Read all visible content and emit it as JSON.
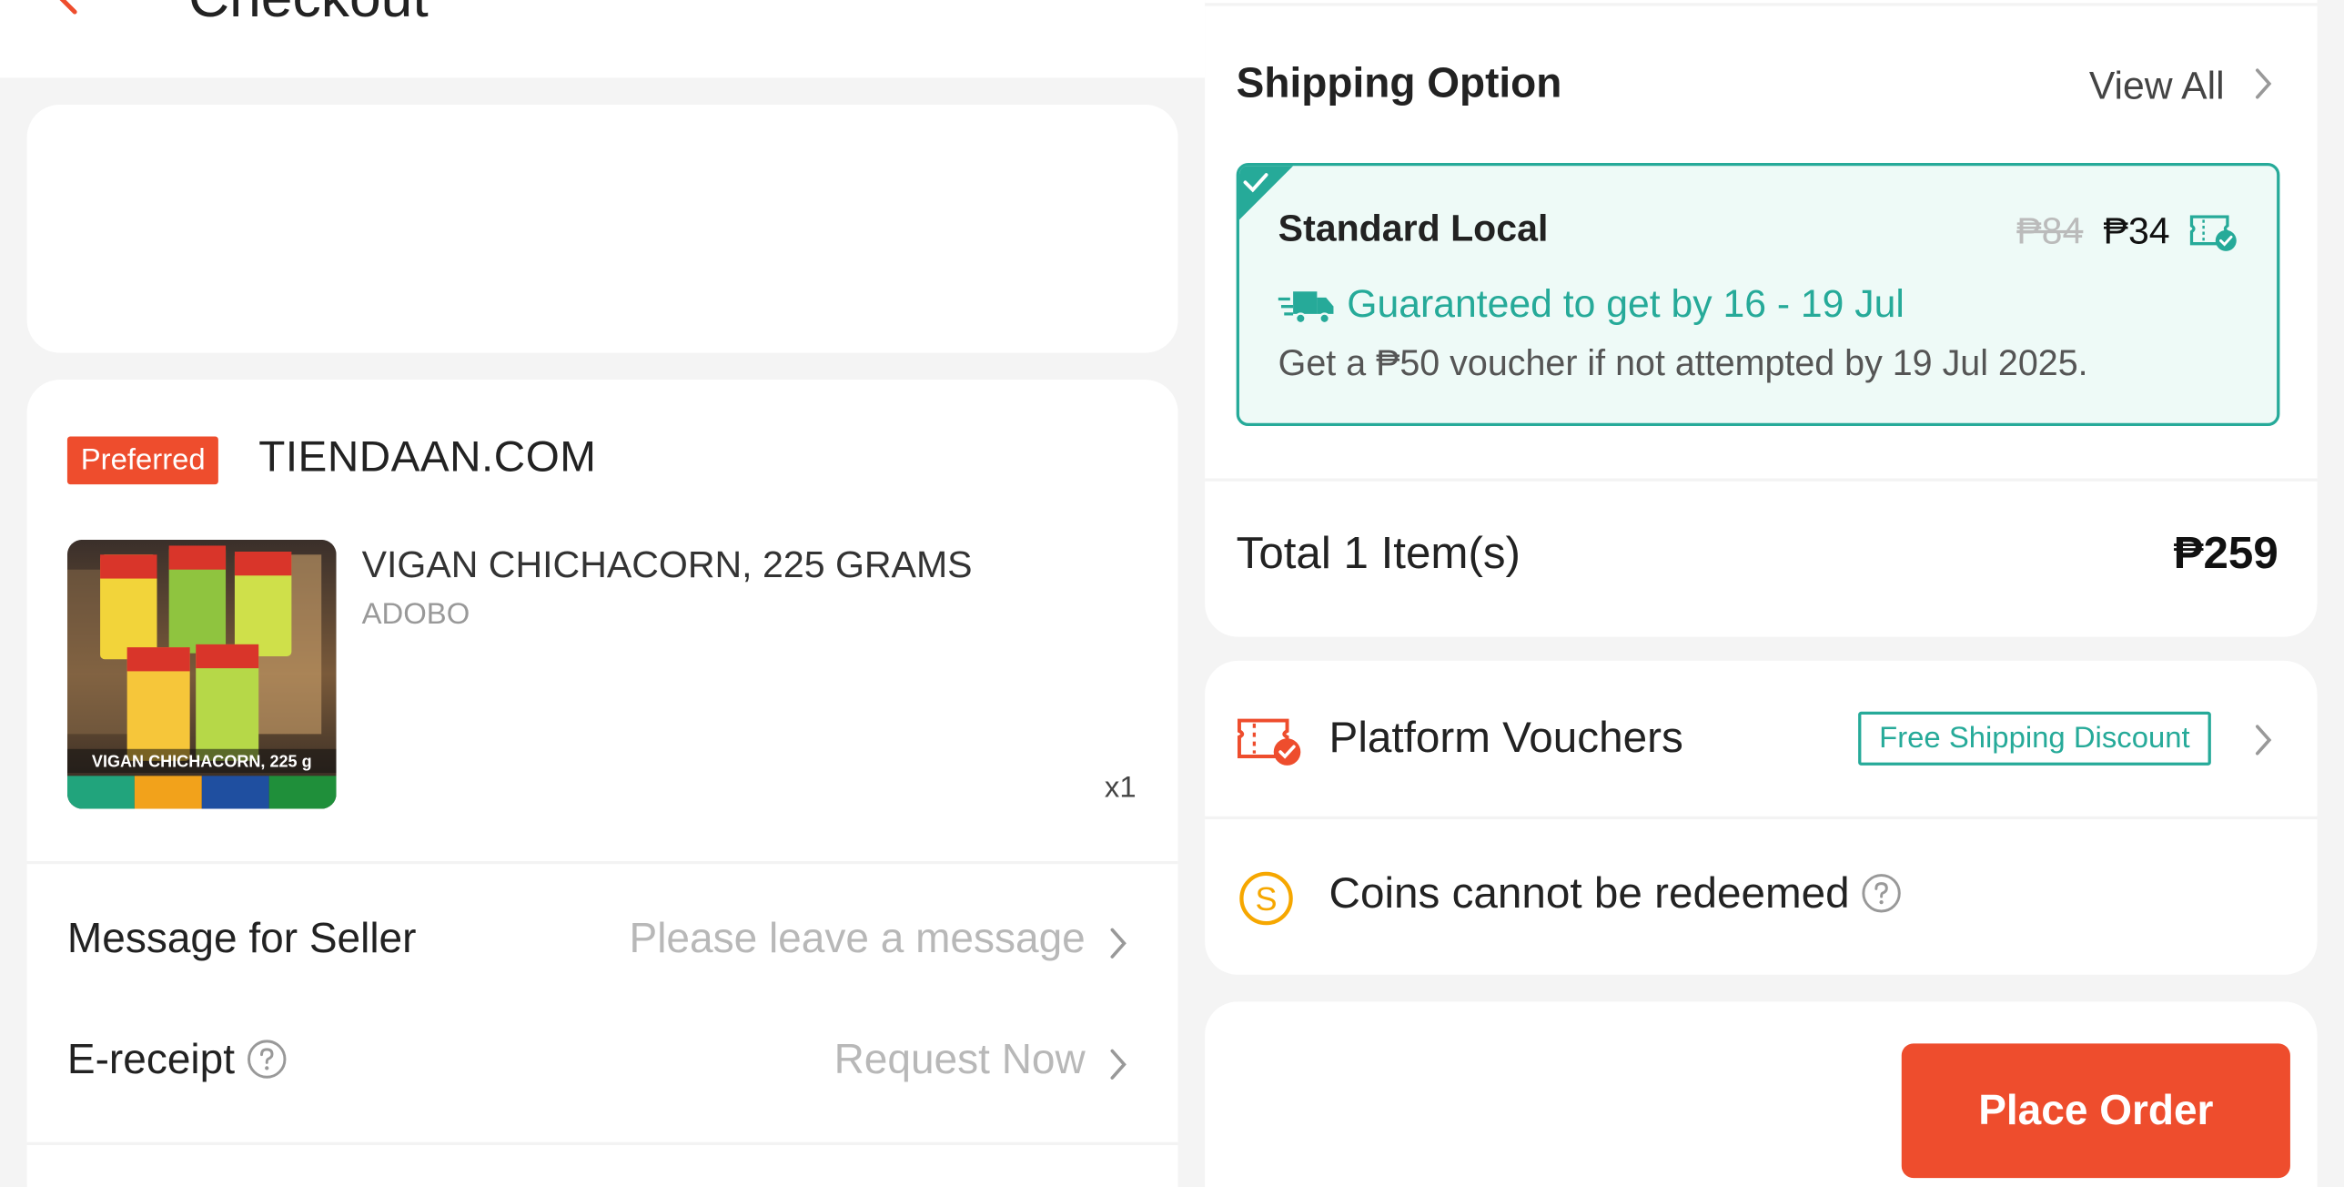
{
  "header": {
    "title": "Checkout"
  },
  "shop": {
    "badge": "Preferred",
    "name": "TIENDAAN.COM"
  },
  "product": {
    "name": "VIGAN CHICHACORN, 225 GRAMS",
    "variant": "ADOBO",
    "quantity": "x1",
    "image_caption": "VIGAN CHICHACORN, 225 g"
  },
  "message_row": {
    "label": "Message for Seller",
    "placeholder": "Please leave a message"
  },
  "ereceipt_row": {
    "label": "E-receipt",
    "value": "Request Now"
  },
  "shipping": {
    "title": "Shipping Option",
    "view_all": "View All",
    "option_name": "Standard Local",
    "old_price": "₱84",
    "new_price": "₱34",
    "guarantee": "Guaranteed to get by 16 - 19 Jul",
    "voucher_note": "Get a ₱50 voucher if not attempted by 19 Jul 2025."
  },
  "total": {
    "label": "Total 1 Item(s)",
    "value": "₱259"
  },
  "vouchers": {
    "label": "Platform Vouchers",
    "tag": "Free Shipping Discount"
  },
  "coins": {
    "label": "Coins cannot be redeemed"
  },
  "footer": {
    "place_order": "Place Order"
  },
  "colors": {
    "brand": "#ee4d2d",
    "teal": "#26aa99",
    "coin": "#f6a700"
  }
}
